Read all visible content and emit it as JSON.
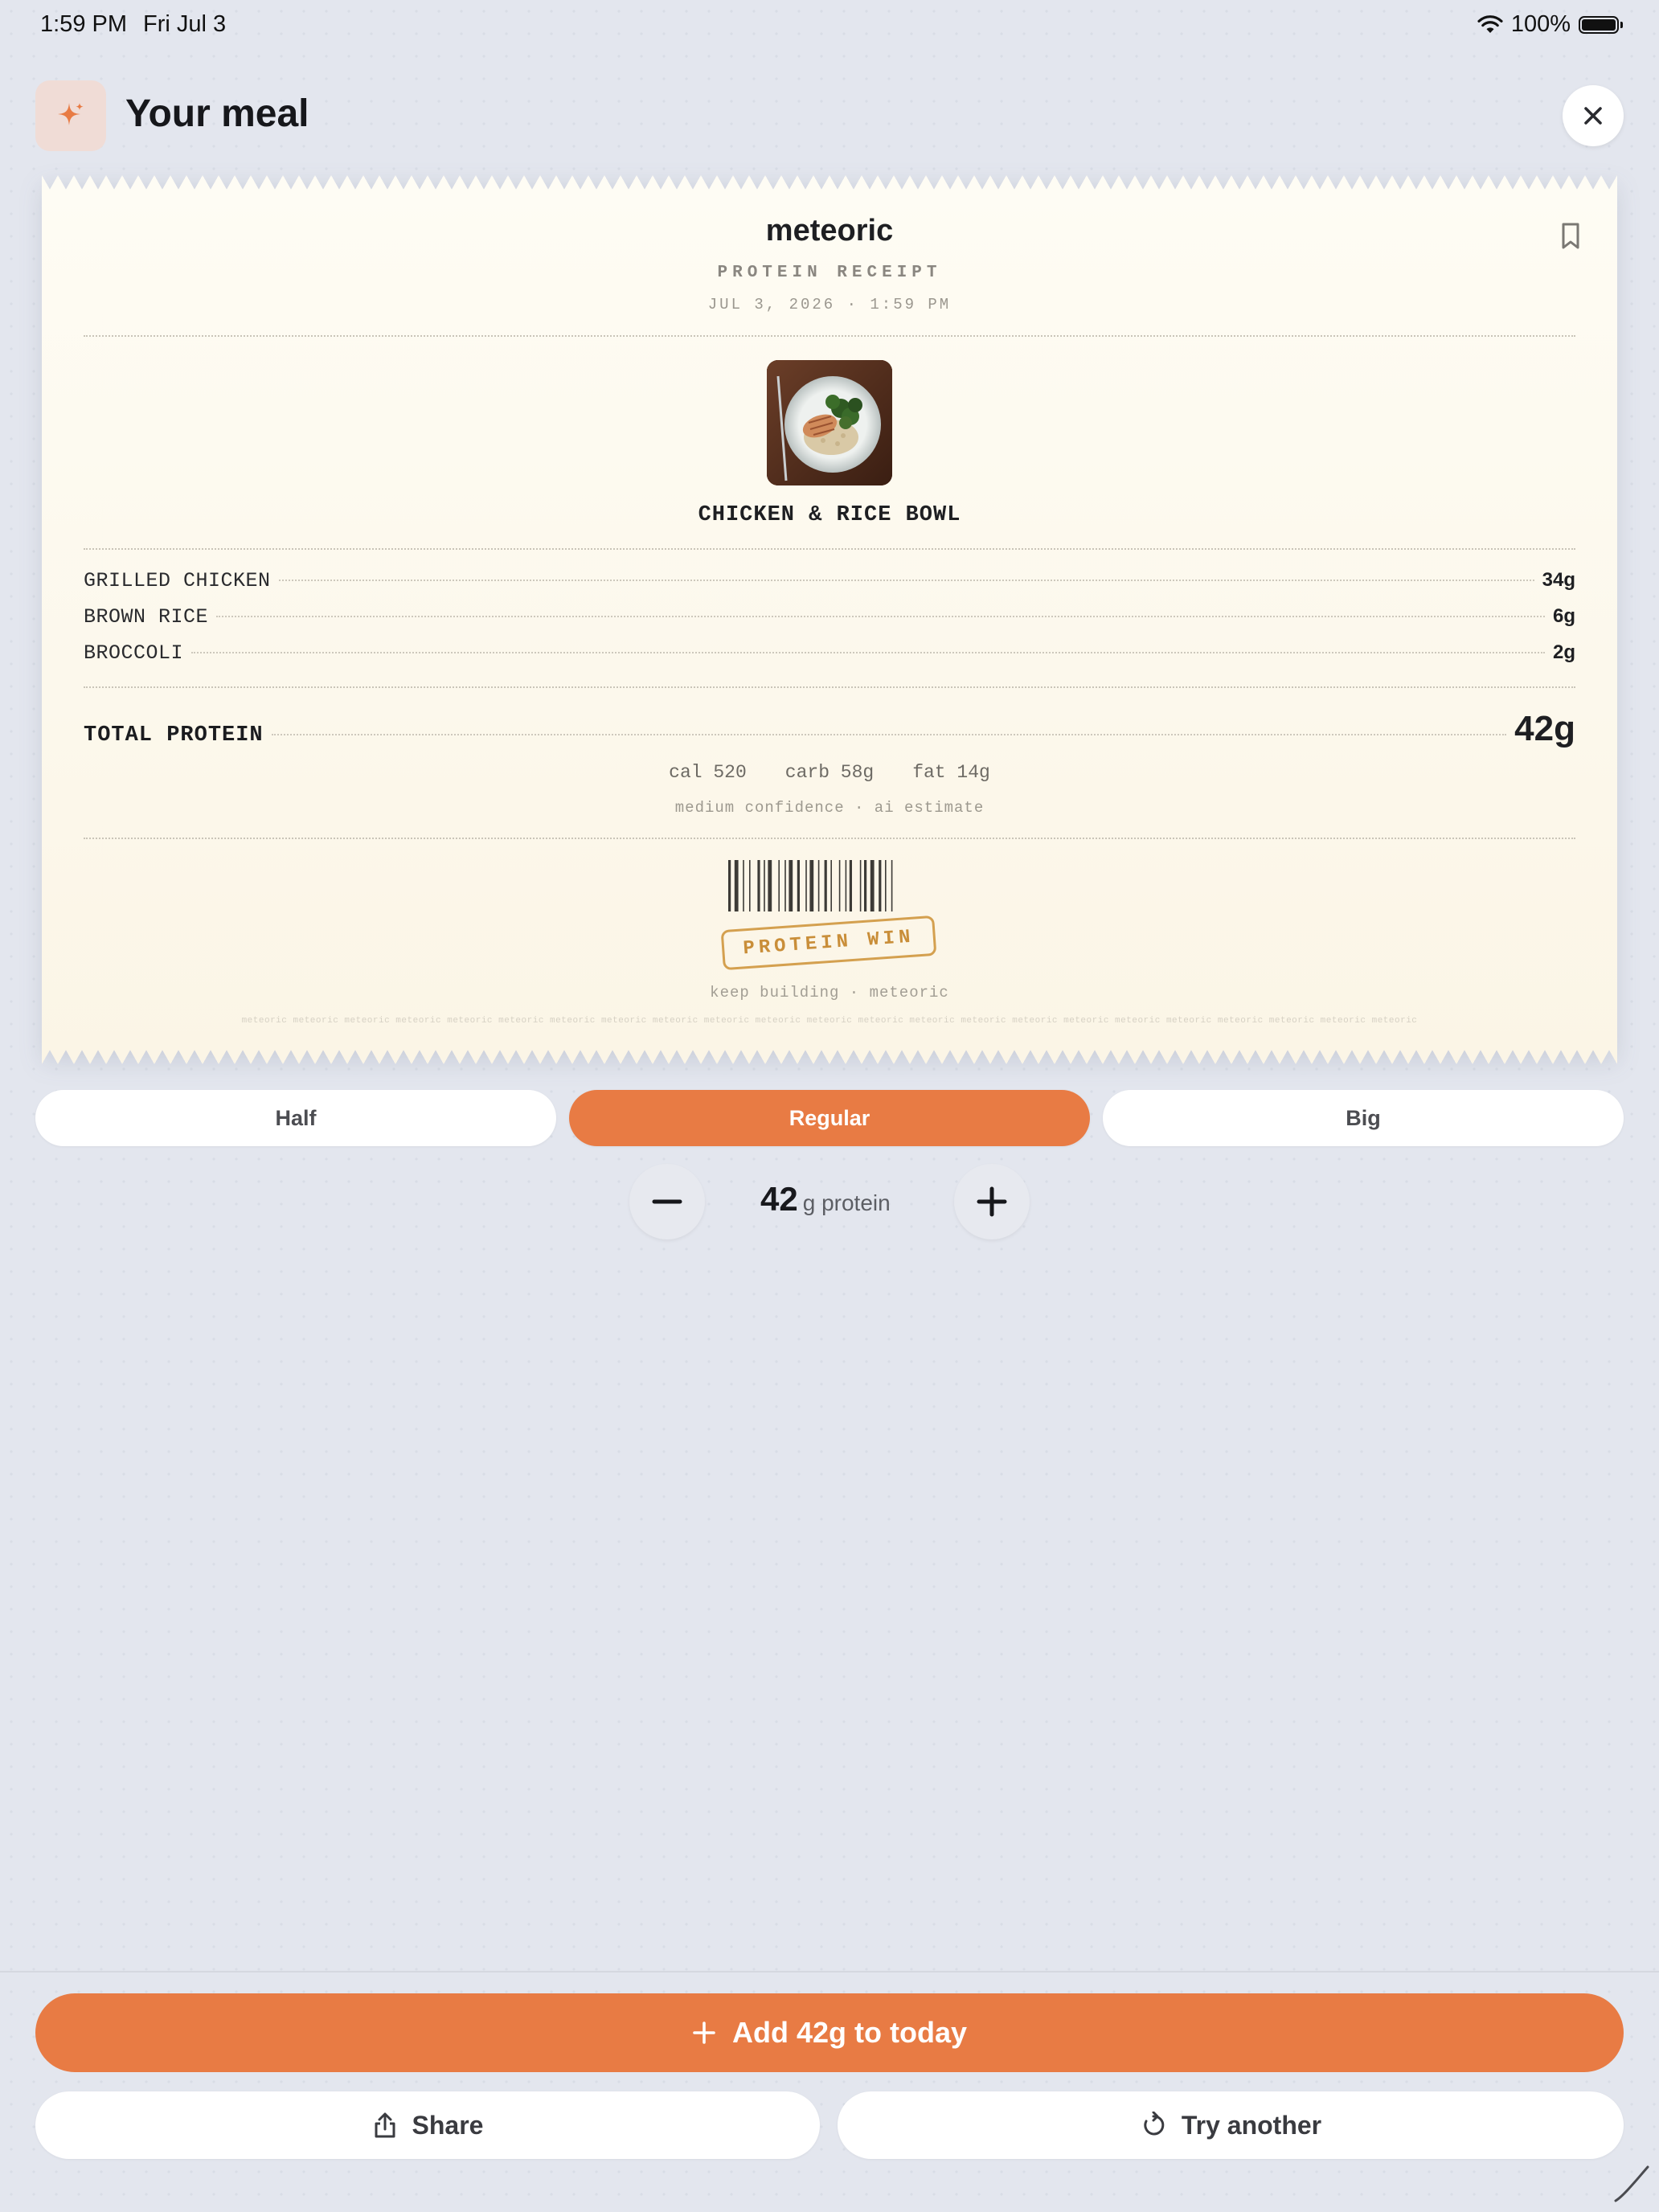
{
  "status_bar": {
    "time": "1:59 PM",
    "date": "Fri Jul 3",
    "battery": "100%"
  },
  "header": {
    "title": "Your meal",
    "icon": "sparkle-icon",
    "close_icon": "close-icon"
  },
  "receipt": {
    "brand": "meteoric",
    "subtitle": "PROTEIN RECEIPT",
    "date_line": "JUL 3, 2026 · 1:59 PM",
    "meal_name": "CHICKEN & RICE BOWL",
    "items": [
      {
        "name": "GRILLED CHICKEN",
        "protein": "34g"
      },
      {
        "name": "BROWN RICE",
        "protein": "6g"
      },
      {
        "name": "BROCCOLI",
        "protein": "2g"
      }
    ],
    "total_label": "TOTAL PROTEIN",
    "total_value": "42g",
    "macros": {
      "cal": "cal 520",
      "carb": "carb 58g",
      "fat": "fat 14g"
    },
    "confidence": "medium confidence · ai estimate",
    "stamp": "PROTEIN WIN",
    "footer": "keep building · meteoric",
    "watermark": "meteoric meteoric meteoric meteoric meteoric meteoric meteoric meteoric meteoric meteoric meteoric meteoric meteoric meteoric meteoric meteoric meteoric meteoric meteoric meteoric meteoric meteoric meteoric"
  },
  "portion": {
    "options": [
      "Half",
      "Regular",
      "Big"
    ],
    "selected": "Regular"
  },
  "stepper": {
    "value": "42",
    "unit": "g protein"
  },
  "actions": {
    "add_label": "Add 42g to today",
    "share_label": "Share",
    "try_another_label": "Try another"
  },
  "colors": {
    "accent": "#e87b44",
    "stamp": "#d4a04f",
    "background": "#e3e6ee",
    "receipt": "#fdf9ee"
  }
}
